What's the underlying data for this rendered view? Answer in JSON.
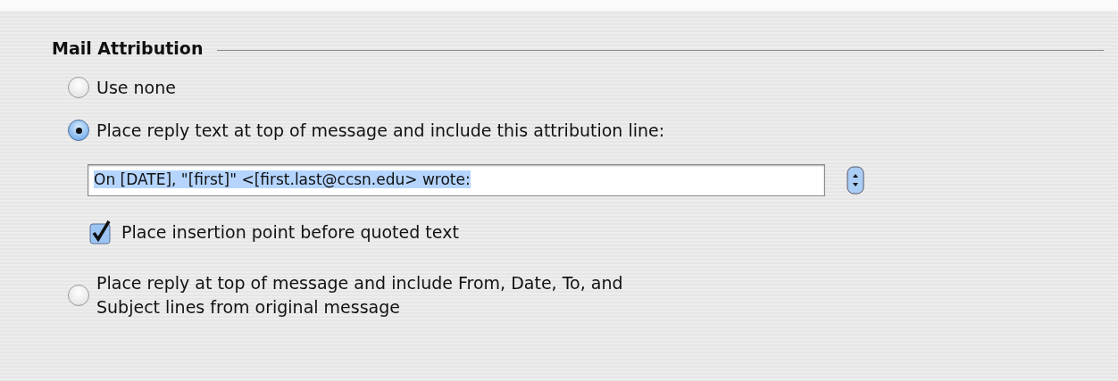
{
  "section": {
    "title": "Mail Attribution"
  },
  "options": [
    {
      "kind": "radio",
      "label": "Use none",
      "selected": false
    },
    {
      "kind": "radio",
      "label": "Place reply text at top of message and include this attribution line:",
      "selected": true
    },
    {
      "kind": "field",
      "value": "On [DATE], \"[first]\" <[first.last@ccsn.edu> wrote:",
      "text_selected": true
    },
    {
      "kind": "checkbox",
      "label": "Place insertion point before quoted text",
      "checked": true
    },
    {
      "kind": "radio",
      "label": "Place reply at top of message and include From, Date, To, and\nSubject lines from original message",
      "selected": false
    }
  ]
}
